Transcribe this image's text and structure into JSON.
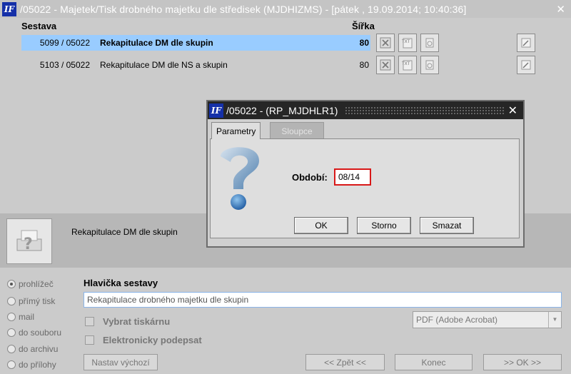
{
  "window": {
    "title": "/05022 - Majetek/Tisk drobného majetku dle středisek (MJDHIZMS) - [pátek  , 19.09.2014; 10:40:36]",
    "close_glyph": "✕"
  },
  "reports": {
    "col_sestava": "Sestava",
    "col_sirka": "Šířka",
    "rows": [
      {
        "code": "5099 / 05022",
        "name": "Rekapitulace DM dle skupin",
        "width": "80",
        "selected": true
      },
      {
        "code": "5103 / 05022",
        "name": "Rekapitulace DM dle NS a skupin",
        "width": "80",
        "selected": false
      }
    ],
    "icons": [
      "excel-icon",
      "txt-icon",
      "print-icon",
      "edit-icon"
    ]
  },
  "preview": {
    "label": "Rekapitulace DM dle skupin"
  },
  "output": {
    "options": [
      {
        "label": "prohlížeč",
        "selected": true
      },
      {
        "label": "přímý tisk",
        "selected": false
      },
      {
        "label": "mail",
        "selected": false
      },
      {
        "label": "do souboru",
        "selected": false
      },
      {
        "label": "do archivu",
        "selected": false
      },
      {
        "label": "do přílohy",
        "selected": false
      }
    ]
  },
  "header": {
    "label": "Hlavička sestavy",
    "value": "Rekapitulace drobného majetku dle skupin",
    "choose_printer": "Vybrat tiskárnu",
    "e_sign": "Elektronicky podepsat",
    "printer_value": "PDF (Adobe Acrobat)"
  },
  "buttons": {
    "defaults": "Nastav výchozí",
    "back": "<< Zpět <<",
    "end": "Konec",
    "ok": ">> OK >>"
  },
  "dialog": {
    "title": "/05022 - (RP_MJDHLR1)",
    "close_glyph": "✕",
    "tab_params": "Parametry",
    "tab_columns": "Sloupce",
    "period_label": "Období:",
    "period_value": "08/14",
    "ok": "OK",
    "cancel": "Storno",
    "clear": "Smazat"
  },
  "colors": {
    "selection": "#99ccff",
    "logo_blue": "#1530a8",
    "dialog_title": "#262626",
    "input_error_border": "#d81818"
  }
}
